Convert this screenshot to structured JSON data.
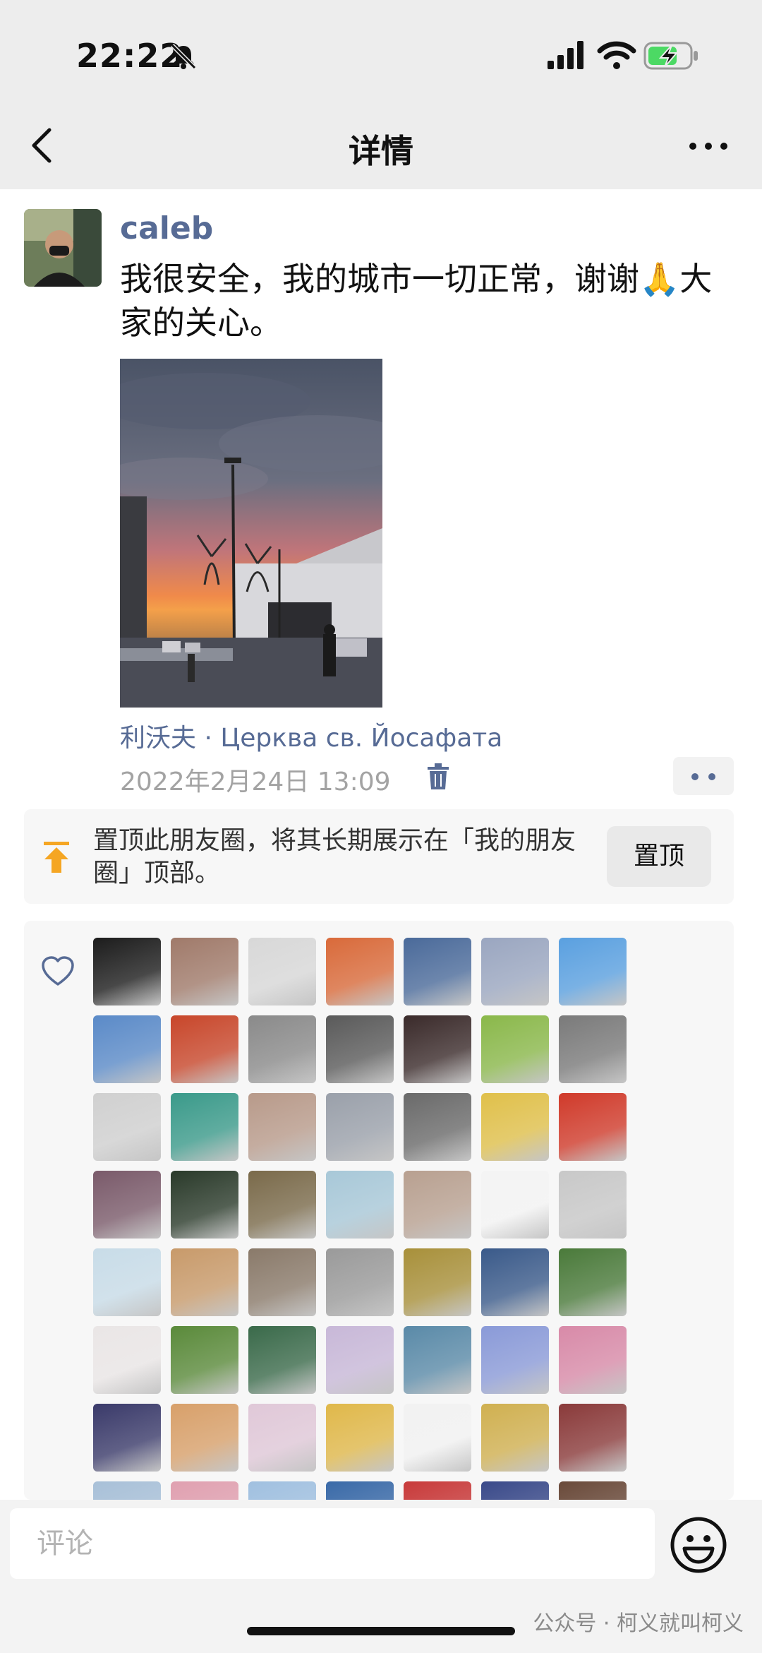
{
  "status_bar": {
    "time": "22:22"
  },
  "nav": {
    "title": "详情"
  },
  "post": {
    "author": "caleb",
    "text": "我很安全，我的城市一切正常，谢谢🙏大家的关心。",
    "location": "利沃夫 · Церква св. Йосафата",
    "timestamp": "2022年2月24日 13:09"
  },
  "pin_banner": {
    "text": "置顶此朋友圈，将其长期展示在「我的朋友圈」顶部。",
    "button_label": "置顶"
  },
  "likes": {
    "colors": [
      "#1c1c1c",
      "#a07a6a",
      "#d8d8d8",
      "#d96a3a",
      "#4a6a9a",
      "#9aa6c0",
      "#5aa0e0",
      "#5a8ac8",
      "#c8462a",
      "#8a8a8a",
      "#5a5a5a",
      "#3a2a2a",
      "#8ab84a",
      "#7a7a7a",
      "#d0d0d0",
      "#3a9a8a",
      "#b89a8a",
      "#9aa0aa",
      "#6a6a6a",
      "#e0c04a",
      "#d03a2a",
      "#7a5a6a",
      "#2a3a2a",
      "#7a6a4a",
      "#a8c8d8",
      "#b8a090",
      "#f4f4f4",
      "#c8c8c8",
      "#c8dce8",
      "#c89a6a",
      "#8a7a6a",
      "#9a9a9a",
      "#a8903a",
      "#3a5a8a",
      "#4a7a3a",
      "#eae6e6",
      "#5a8a3a",
      "#3a6a4a",
      "#c8b8d8",
      "#5a8aa8",
      "#8a9ad8",
      "#d88aa8",
      "#3a3a6a",
      "#d8a06a",
      "#e0c8d8",
      "#e0b84a",
      "#f2f2f2",
      "#d0b050",
      "#8a3a3a",
      "#a8c0d8",
      "#e0a0b0",
      "#a0c0e0",
      "#3a6aa8",
      "#c83a3a",
      "#3a4a8a",
      "#6a4a3a"
    ]
  },
  "comment_bar": {
    "placeholder": "评论",
    "watermark": "公众号 · 柯义就叫柯义"
  }
}
